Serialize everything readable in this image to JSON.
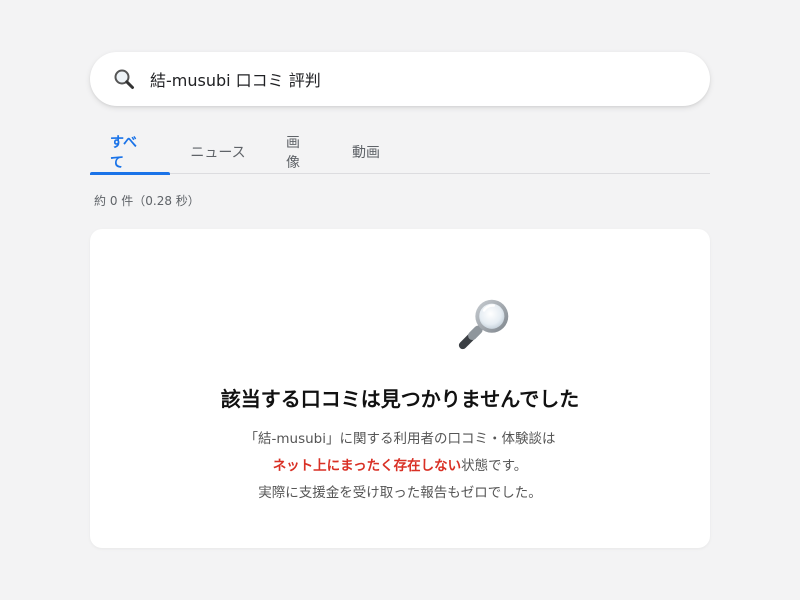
{
  "search": {
    "query": "結-musubi 口コミ 評判",
    "icon": "search-icon"
  },
  "tabs": [
    {
      "label": "すべて",
      "active": true
    },
    {
      "label": "ニュース",
      "active": false
    },
    {
      "label": "画像",
      "active": false
    },
    {
      "label": "動画",
      "active": false
    }
  ],
  "results": {
    "count_text": "約 0 件（0.28 秒）"
  },
  "empty_state": {
    "icon": "magnifying-glass-icon",
    "heading": "該当する口コミは見つかりませんでした",
    "line1": "「結-musubi」に関する利用者の口コミ・体験談は",
    "line2_highlight": "ネット上にまったく存在しない",
    "line2_rest": "状態です。",
    "line3": "実際に支援金を受け取った報告もゼロでした。"
  },
  "colors": {
    "accent": "#1a73e8",
    "highlight": "#d93025",
    "background": "#f3f3f4"
  }
}
